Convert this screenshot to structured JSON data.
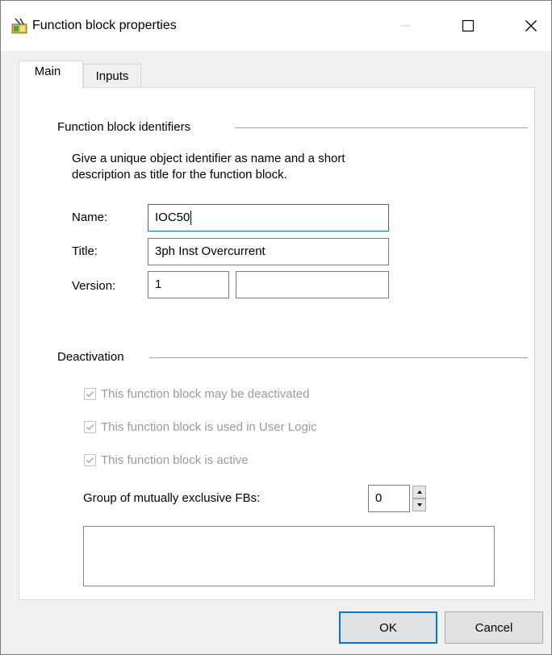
{
  "window": {
    "title": "Function block properties",
    "icon": "function-block-app-icon",
    "controls": [
      "minimize-icon",
      "maximize-icon",
      "close-icon"
    ]
  },
  "tabs": [
    {
      "label": "Main",
      "selected": true
    },
    {
      "label": "Inputs",
      "selected": false
    }
  ],
  "identifiers": {
    "group_label": "Function block identifiers",
    "description_line1": "Give a unique object identifier as name and a short",
    "description_line2": "description as title for the function block.",
    "name_label": "Name:",
    "name_value": "IOC50",
    "title_label": "Title:",
    "title_value": "3ph Inst Overcurrent",
    "version_label": "Version:",
    "version_value": "1",
    "version_extra_value": ""
  },
  "deactivation": {
    "group_label": "Deactivation",
    "checks": [
      {
        "label": "This function block may be deactivated",
        "checked": true,
        "enabled": false
      },
      {
        "label": "This function block is used in User Logic",
        "checked": true,
        "enabled": false
      },
      {
        "label": "This function block is active",
        "checked": true,
        "enabled": false
      }
    ],
    "group_exclusive_label": "Group of mutually exclusive FBs:",
    "group_exclusive_value": "0"
  },
  "buttons": {
    "ok": "OK",
    "cancel": "Cancel"
  },
  "colors": {
    "accent": "#0078d7",
    "disabled_text": "#9a9a9a",
    "dialog_bg": "#f0f0f0"
  }
}
